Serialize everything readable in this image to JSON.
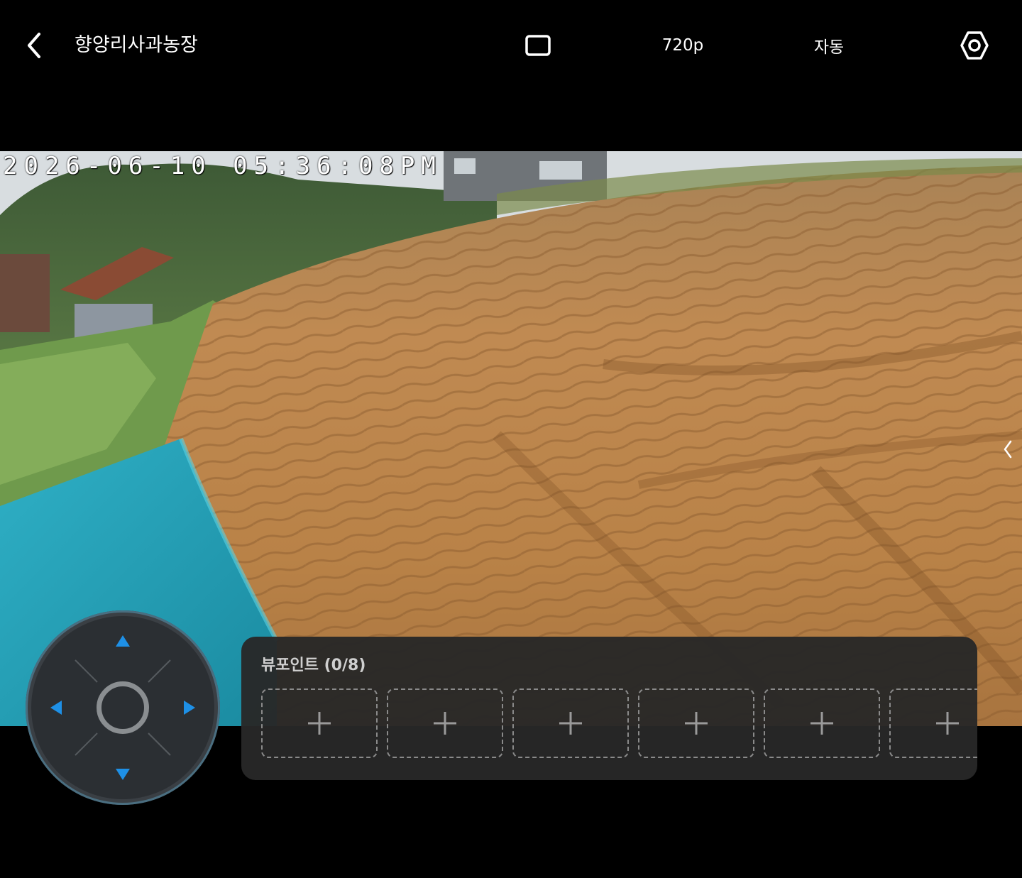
{
  "header": {
    "title": "향양리사과농장",
    "quality_label": "720p",
    "auto_label": "자동"
  },
  "video": {
    "timestamp": "2026-06-10 05:36:08PM"
  },
  "viewpoints": {
    "title": "뷰포인트 (0/8)",
    "slots": [
      "+",
      "+",
      "+",
      "+",
      "+",
      "+"
    ]
  },
  "colors": {
    "joystick_arrow": "#1e90e6",
    "panel_bg": "#282828",
    "text_primary": "#ffffff"
  }
}
